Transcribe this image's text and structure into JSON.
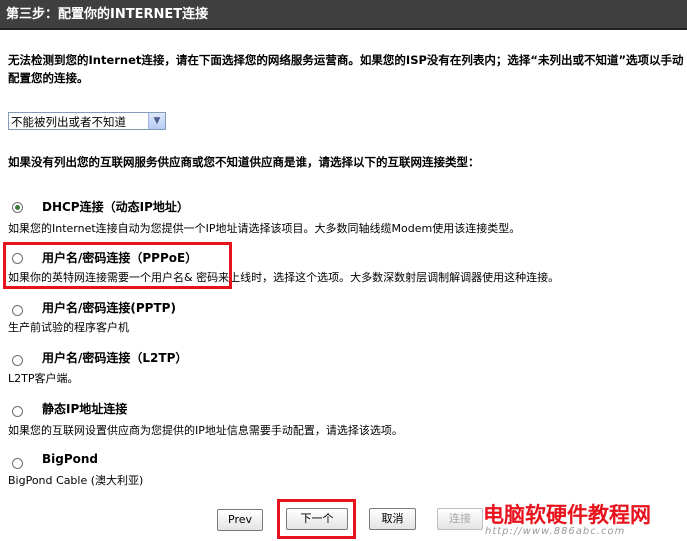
{
  "header": {
    "title": "第三步：配置你的INTERNET连接"
  },
  "intro": {
    "text": "无法检测到您的Internet连接，请在下面选择您的网络服务运营商。如果您的ISP没有在列表内；选择“未列出或不知道”选项以手动配置您的连接。"
  },
  "isp_select": {
    "value": "不能被列出或者不知道"
  },
  "prompt": {
    "text": "如果没有列出您的互联网服务供应商或您不知道供应商是谁，请选择以下的互联网连接类型："
  },
  "options": [
    {
      "label": "DHCP连接（动态IP地址）",
      "description": "如果您的Internet连接自动为您提供一个IP地址请选择该项目。大多数同轴线缆Modem使用该连接类型。",
      "checked": true
    },
    {
      "label": "用户名/密码连接（PPPoE）",
      "description": "如果你的英特网连接需要一个用户名& 密码来上线时，选择这个选项。大多数深数射层调制解调器使用这种连接。",
      "checked": false
    },
    {
      "label": "用户名/密码连接(PPTP)",
      "description": "生产前试验的程序客户机",
      "checked": false
    },
    {
      "label": "用户名/密码连接（L2TP）",
      "description": "L2TP客户端。",
      "checked": false
    },
    {
      "label": "静态IP地址连接",
      "description": "如果您的互联网设置供应商为您提供的IP地址信息需要手动配置，请选择该选项。",
      "checked": false
    },
    {
      "label": "BigPond",
      "description": "BigPond Cable (澳大利亚)",
      "checked": false
    }
  ],
  "buttons": {
    "prev": "Prev",
    "next": "下一个",
    "cancel": "取消",
    "connect": "连接"
  },
  "watermark": {
    "text": "电脑软硬件教程网",
    "url": "http://www.886abc.com"
  },
  "colors": {
    "highlight": "#e8121c",
    "title_bar": "#3f3f3f"
  }
}
